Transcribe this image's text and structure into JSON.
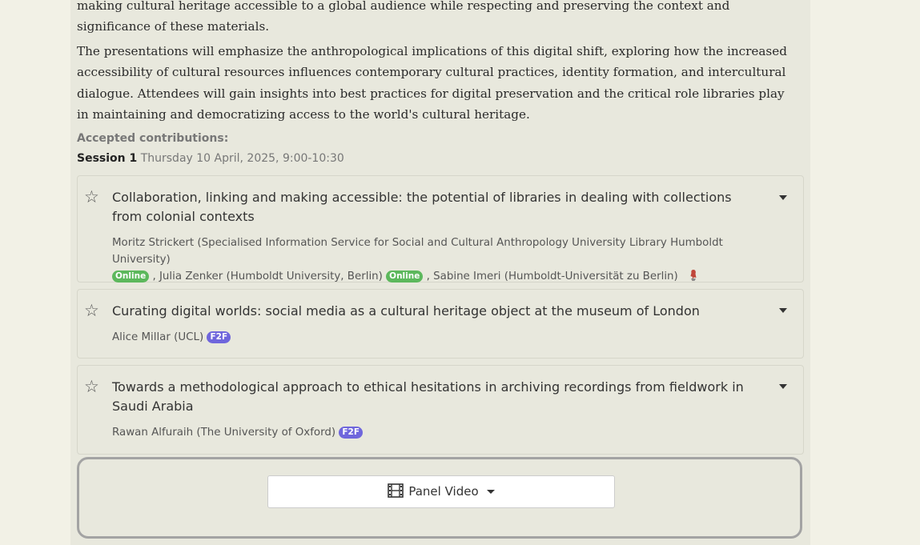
{
  "description": {
    "paragraph1": "making cultural heritage accessible to a global audience while respecting and preserving the context and significance of these materials.",
    "paragraph2": "The presentations will emphasize the anthropological implications of this digital shift, exploring how the increased accessibility of cultural resources influences contemporary cultural practices, identity formation, and intercultural dialogue. Attendees will gain insights into best practices for digital preservation and the critical role libraries play in maintaining and democratizing access to the world's cultural heritage."
  },
  "accepted_label": "Accepted contributions:",
  "session": {
    "name": "Session 1",
    "time": "Thursday 10 April, 2025, 9:00-10:30"
  },
  "papers": [
    {
      "title": "Collaboration, linking and making accessible: the potential of libraries in dealing with collections from colonial contexts",
      "authors": [
        {
          "text": "Moritz Strickert (Specialised Information Service for Social and Cultural Anthropology University Library Humboldt University)",
          "badge": "Online"
        },
        {
          "text": ", Julia Zenker (Humboldt University, Berlin)",
          "badge": "Online"
        },
        {
          "text": ", Sabine Imeri (Humboldt-Universität zu Berlin)",
          "badge": ""
        }
      ],
      "icon": "pin-icon"
    },
    {
      "title": "Curating digital worlds: social media as a cultural heritage object at the museum of London",
      "authors": [
        {
          "text": "Alice Millar (UCL)",
          "badge": "F2F"
        }
      ]
    },
    {
      "title": "Towards a methodological approach to ethical hesitations in archiving recordings from fieldwork in Saudi Arabia",
      "authors": [
        {
          "text": "Rawan Alfuraih (The University of Oxford)",
          "badge": "F2F"
        }
      ]
    }
  ],
  "video": {
    "label": "Panel Video",
    "icon": "film-icon"
  },
  "colors": {
    "online": "#5cb85c",
    "f2f": "#6f66dc",
    "background": "#e8e8dd"
  }
}
